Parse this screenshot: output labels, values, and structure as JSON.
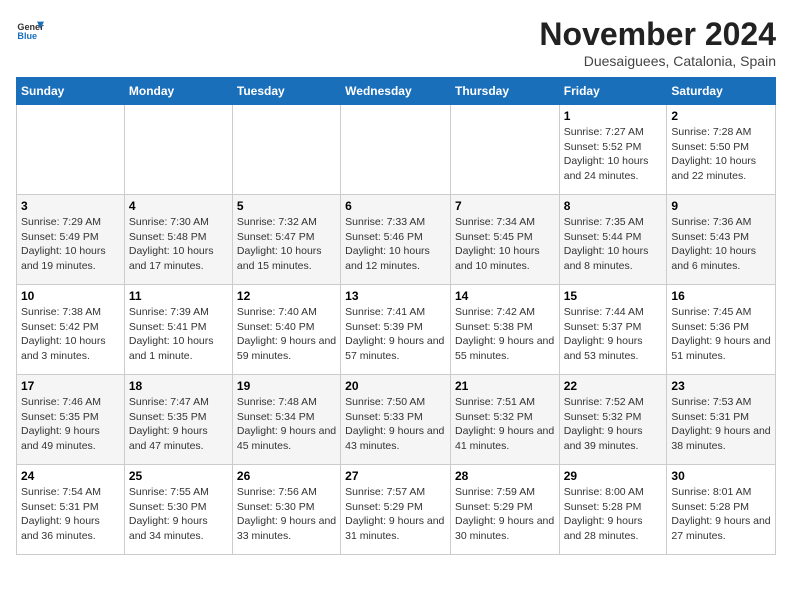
{
  "header": {
    "logo": {
      "general": "General",
      "blue": "Blue"
    },
    "month": "November 2024",
    "location": "Duesaiguees, Catalonia, Spain"
  },
  "weekdays": [
    "Sunday",
    "Monday",
    "Tuesday",
    "Wednesday",
    "Thursday",
    "Friday",
    "Saturday"
  ],
  "weeks": [
    [
      {
        "day": "",
        "info": ""
      },
      {
        "day": "",
        "info": ""
      },
      {
        "day": "",
        "info": ""
      },
      {
        "day": "",
        "info": ""
      },
      {
        "day": "",
        "info": ""
      },
      {
        "day": "1",
        "info": "Sunrise: 7:27 AM\nSunset: 5:52 PM\nDaylight: 10 hours and 24 minutes."
      },
      {
        "day": "2",
        "info": "Sunrise: 7:28 AM\nSunset: 5:50 PM\nDaylight: 10 hours and 22 minutes."
      }
    ],
    [
      {
        "day": "3",
        "info": "Sunrise: 7:29 AM\nSunset: 5:49 PM\nDaylight: 10 hours and 19 minutes."
      },
      {
        "day": "4",
        "info": "Sunrise: 7:30 AM\nSunset: 5:48 PM\nDaylight: 10 hours and 17 minutes."
      },
      {
        "day": "5",
        "info": "Sunrise: 7:32 AM\nSunset: 5:47 PM\nDaylight: 10 hours and 15 minutes."
      },
      {
        "day": "6",
        "info": "Sunrise: 7:33 AM\nSunset: 5:46 PM\nDaylight: 10 hours and 12 minutes."
      },
      {
        "day": "7",
        "info": "Sunrise: 7:34 AM\nSunset: 5:45 PM\nDaylight: 10 hours and 10 minutes."
      },
      {
        "day": "8",
        "info": "Sunrise: 7:35 AM\nSunset: 5:44 PM\nDaylight: 10 hours and 8 minutes."
      },
      {
        "day": "9",
        "info": "Sunrise: 7:36 AM\nSunset: 5:43 PM\nDaylight: 10 hours and 6 minutes."
      }
    ],
    [
      {
        "day": "10",
        "info": "Sunrise: 7:38 AM\nSunset: 5:42 PM\nDaylight: 10 hours and 3 minutes."
      },
      {
        "day": "11",
        "info": "Sunrise: 7:39 AM\nSunset: 5:41 PM\nDaylight: 10 hours and 1 minute."
      },
      {
        "day": "12",
        "info": "Sunrise: 7:40 AM\nSunset: 5:40 PM\nDaylight: 9 hours and 59 minutes."
      },
      {
        "day": "13",
        "info": "Sunrise: 7:41 AM\nSunset: 5:39 PM\nDaylight: 9 hours and 57 minutes."
      },
      {
        "day": "14",
        "info": "Sunrise: 7:42 AM\nSunset: 5:38 PM\nDaylight: 9 hours and 55 minutes."
      },
      {
        "day": "15",
        "info": "Sunrise: 7:44 AM\nSunset: 5:37 PM\nDaylight: 9 hours and 53 minutes."
      },
      {
        "day": "16",
        "info": "Sunrise: 7:45 AM\nSunset: 5:36 PM\nDaylight: 9 hours and 51 minutes."
      }
    ],
    [
      {
        "day": "17",
        "info": "Sunrise: 7:46 AM\nSunset: 5:35 PM\nDaylight: 9 hours and 49 minutes."
      },
      {
        "day": "18",
        "info": "Sunrise: 7:47 AM\nSunset: 5:35 PM\nDaylight: 9 hours and 47 minutes."
      },
      {
        "day": "19",
        "info": "Sunrise: 7:48 AM\nSunset: 5:34 PM\nDaylight: 9 hours and 45 minutes."
      },
      {
        "day": "20",
        "info": "Sunrise: 7:50 AM\nSunset: 5:33 PM\nDaylight: 9 hours and 43 minutes."
      },
      {
        "day": "21",
        "info": "Sunrise: 7:51 AM\nSunset: 5:32 PM\nDaylight: 9 hours and 41 minutes."
      },
      {
        "day": "22",
        "info": "Sunrise: 7:52 AM\nSunset: 5:32 PM\nDaylight: 9 hours and 39 minutes."
      },
      {
        "day": "23",
        "info": "Sunrise: 7:53 AM\nSunset: 5:31 PM\nDaylight: 9 hours and 38 minutes."
      }
    ],
    [
      {
        "day": "24",
        "info": "Sunrise: 7:54 AM\nSunset: 5:31 PM\nDaylight: 9 hours and 36 minutes."
      },
      {
        "day": "25",
        "info": "Sunrise: 7:55 AM\nSunset: 5:30 PM\nDaylight: 9 hours and 34 minutes."
      },
      {
        "day": "26",
        "info": "Sunrise: 7:56 AM\nSunset: 5:30 PM\nDaylight: 9 hours and 33 minutes."
      },
      {
        "day": "27",
        "info": "Sunrise: 7:57 AM\nSunset: 5:29 PM\nDaylight: 9 hours and 31 minutes."
      },
      {
        "day": "28",
        "info": "Sunrise: 7:59 AM\nSunset: 5:29 PM\nDaylight: 9 hours and 30 minutes."
      },
      {
        "day": "29",
        "info": "Sunrise: 8:00 AM\nSunset: 5:28 PM\nDaylight: 9 hours and 28 minutes."
      },
      {
        "day": "30",
        "info": "Sunrise: 8:01 AM\nSunset: 5:28 PM\nDaylight: 9 hours and 27 minutes."
      }
    ]
  ]
}
